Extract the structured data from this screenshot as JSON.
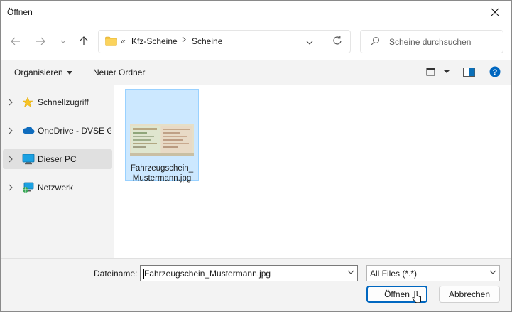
{
  "window": {
    "title": "Öffnen"
  },
  "address": {
    "overflow": "«",
    "crumbs": [
      "Kfz-Scheine",
      "Scheine"
    ]
  },
  "search": {
    "placeholder": "Scheine durchsuchen"
  },
  "toolbar": {
    "organize_label": "Organisieren",
    "new_folder_label": "Neuer Ordner"
  },
  "nav_items": [
    {
      "label": "Schnellzugriff",
      "icon": "star-icon"
    },
    {
      "label": "OneDrive - DVSE Ge",
      "icon": "cloud-icon"
    },
    {
      "label": "Dieser PC",
      "icon": "monitor-icon",
      "selected": true
    },
    {
      "label": "Netzwerk",
      "icon": "network-icon"
    }
  ],
  "files": [
    {
      "name_line1": "Fahrzeugschein_",
      "name_line2": "Mustermann.jpg",
      "selected": true
    }
  ],
  "footer": {
    "filename_label": "Dateiname:",
    "filename_value": "Fahrzeugschein_Mustermann.jpg",
    "filter_value": "All Files (*.*)",
    "open_label": "Öffnen",
    "cancel_label": "Abbrechen"
  },
  "colors": {
    "accent": "#0067c0",
    "selection": "#cce8ff",
    "help": "#0067c0",
    "folder": "#f4c542"
  }
}
